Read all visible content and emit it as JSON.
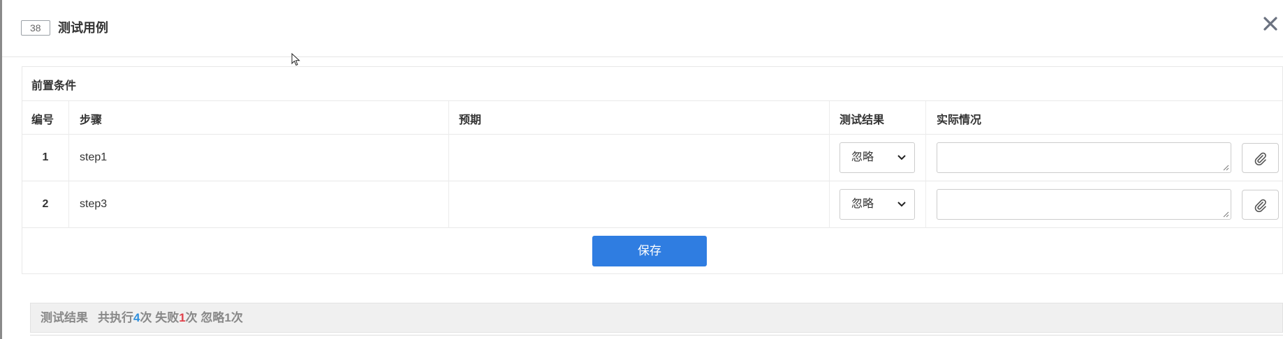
{
  "header": {
    "case_id": "38",
    "title": "测试用例"
  },
  "precondition": {
    "title": "前置条件"
  },
  "table": {
    "columns": [
      "编号",
      "步骤",
      "预期",
      "测试结果",
      "实际情况"
    ],
    "rows": [
      {
        "num": "1",
        "step": "step1",
        "expected": "",
        "result": "忽略",
        "actual": ""
      },
      {
        "num": "2",
        "step": "step3",
        "expected": "",
        "result": "忽略",
        "actual": ""
      }
    ]
  },
  "actions": {
    "save_label": "保存"
  },
  "summary": {
    "label": "测试结果",
    "exec_prefix": "共执行",
    "exec_count": "4",
    "exec_suffix": "次",
    "fail_prefix": "失败",
    "fail_count": "1",
    "fail_suffix": "次",
    "ignore_text": "忽略1次"
  },
  "colors": {
    "primary": "#2f7de1",
    "exec_count": "#2f8fdc",
    "fail_count": "#e0404a"
  },
  "icons": {
    "close": "close-icon",
    "attach": "paperclip-icon",
    "dropdown": "chevron-down-icon",
    "cursor": "mouse-pointer-icon"
  }
}
